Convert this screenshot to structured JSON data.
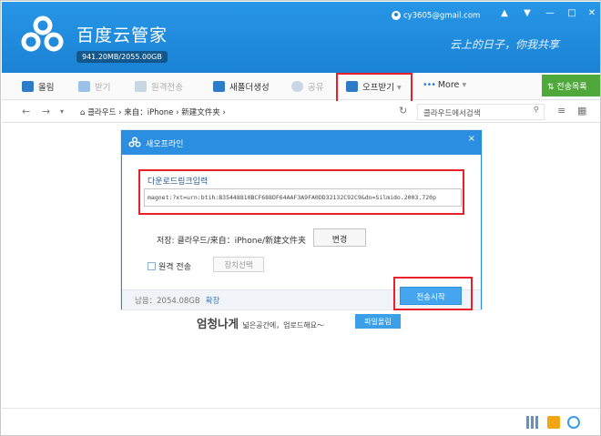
{
  "header": {
    "app_title": "百度云管家",
    "quota": "941.20MB/2055.00GB",
    "account": "cy3605@gmail.com",
    "slogan": "云上的日子，你我共享",
    "accent": "#1d85d8"
  },
  "toolbar": {
    "upload": "올림",
    "download": "받기",
    "remote": "원격전송",
    "new_folder": "새폴더생성",
    "share": "공유",
    "offline": "오프받기",
    "more": "More",
    "transfer_list": "전송목록"
  },
  "addressbar": {
    "breadcrumb": [
      "클라우드",
      "来自：iPhone",
      "新建文件夹"
    ],
    "search_placeholder": "클라우드에서검색"
  },
  "content": {
    "empty_bold": "엄청나게",
    "empty_small": "넓은공간에，업로드해요～",
    "upload_button": "파일올림"
  },
  "dialog": {
    "title": "새오프라인",
    "close": "×",
    "link_label": "다운로드링크입력",
    "link_value": "magnet:?xt=urn:btih:B35448810BCF688DF64AAF3A9FA0DD32132C92C9&dn=Silmido.2003.720p",
    "save_label": "저장:",
    "save_path": "클라우드/来自：iPhone/新建文件夹",
    "change_button": "변경",
    "remote_label": "원격  전송",
    "device_button": "장치선택",
    "space_text": "남음：2054.08GB",
    "expand_link": "확장",
    "start_button": "전송시작"
  }
}
